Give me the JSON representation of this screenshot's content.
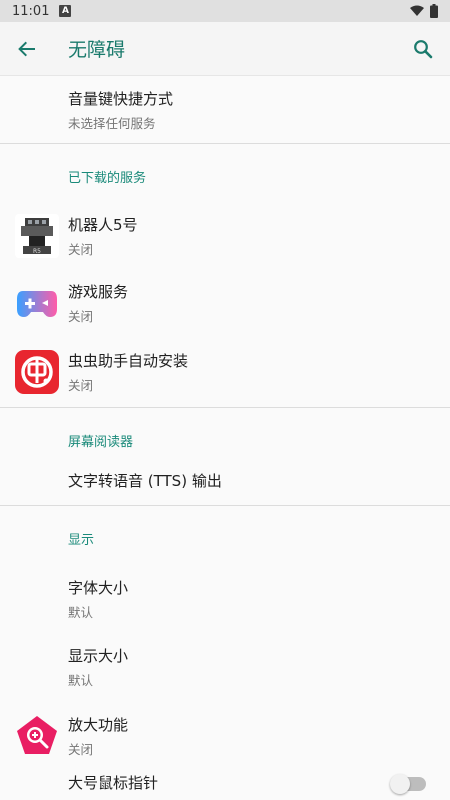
{
  "status_bar": {
    "time": "11:01",
    "notification_badge": "A"
  },
  "app_bar": {
    "title": "无障碍",
    "back_icon": "arrow-back-icon",
    "search_icon": "search-icon"
  },
  "shortcut": {
    "title": "音量键快捷方式",
    "subtitle": "未选择任何服务"
  },
  "downloaded_services": {
    "header": "已下载的服务",
    "items": [
      {
        "title": "机器人5号",
        "subtitle": "关闭"
      },
      {
        "title": "游戏服务",
        "subtitle": "关闭"
      },
      {
        "title": "虫虫助手自动安装",
        "subtitle": "关闭"
      }
    ]
  },
  "screen_reader": {
    "header": "屏幕阅读器",
    "tts": "文字转语音 (TTS) 输出"
  },
  "display": {
    "header": "显示",
    "font_size": {
      "title": "字体大小",
      "subtitle": "默认"
    },
    "display_size": {
      "title": "显示大小",
      "subtitle": "默认"
    },
    "magnification": {
      "title": "放大功能",
      "subtitle": "关闭"
    },
    "large_pointer": {
      "title": "大号鼠标指针",
      "enabled": false
    }
  },
  "colors": {
    "accent": "#1a8a7a",
    "status_bar": "#e0e0e0",
    "background": "#fafafa"
  }
}
